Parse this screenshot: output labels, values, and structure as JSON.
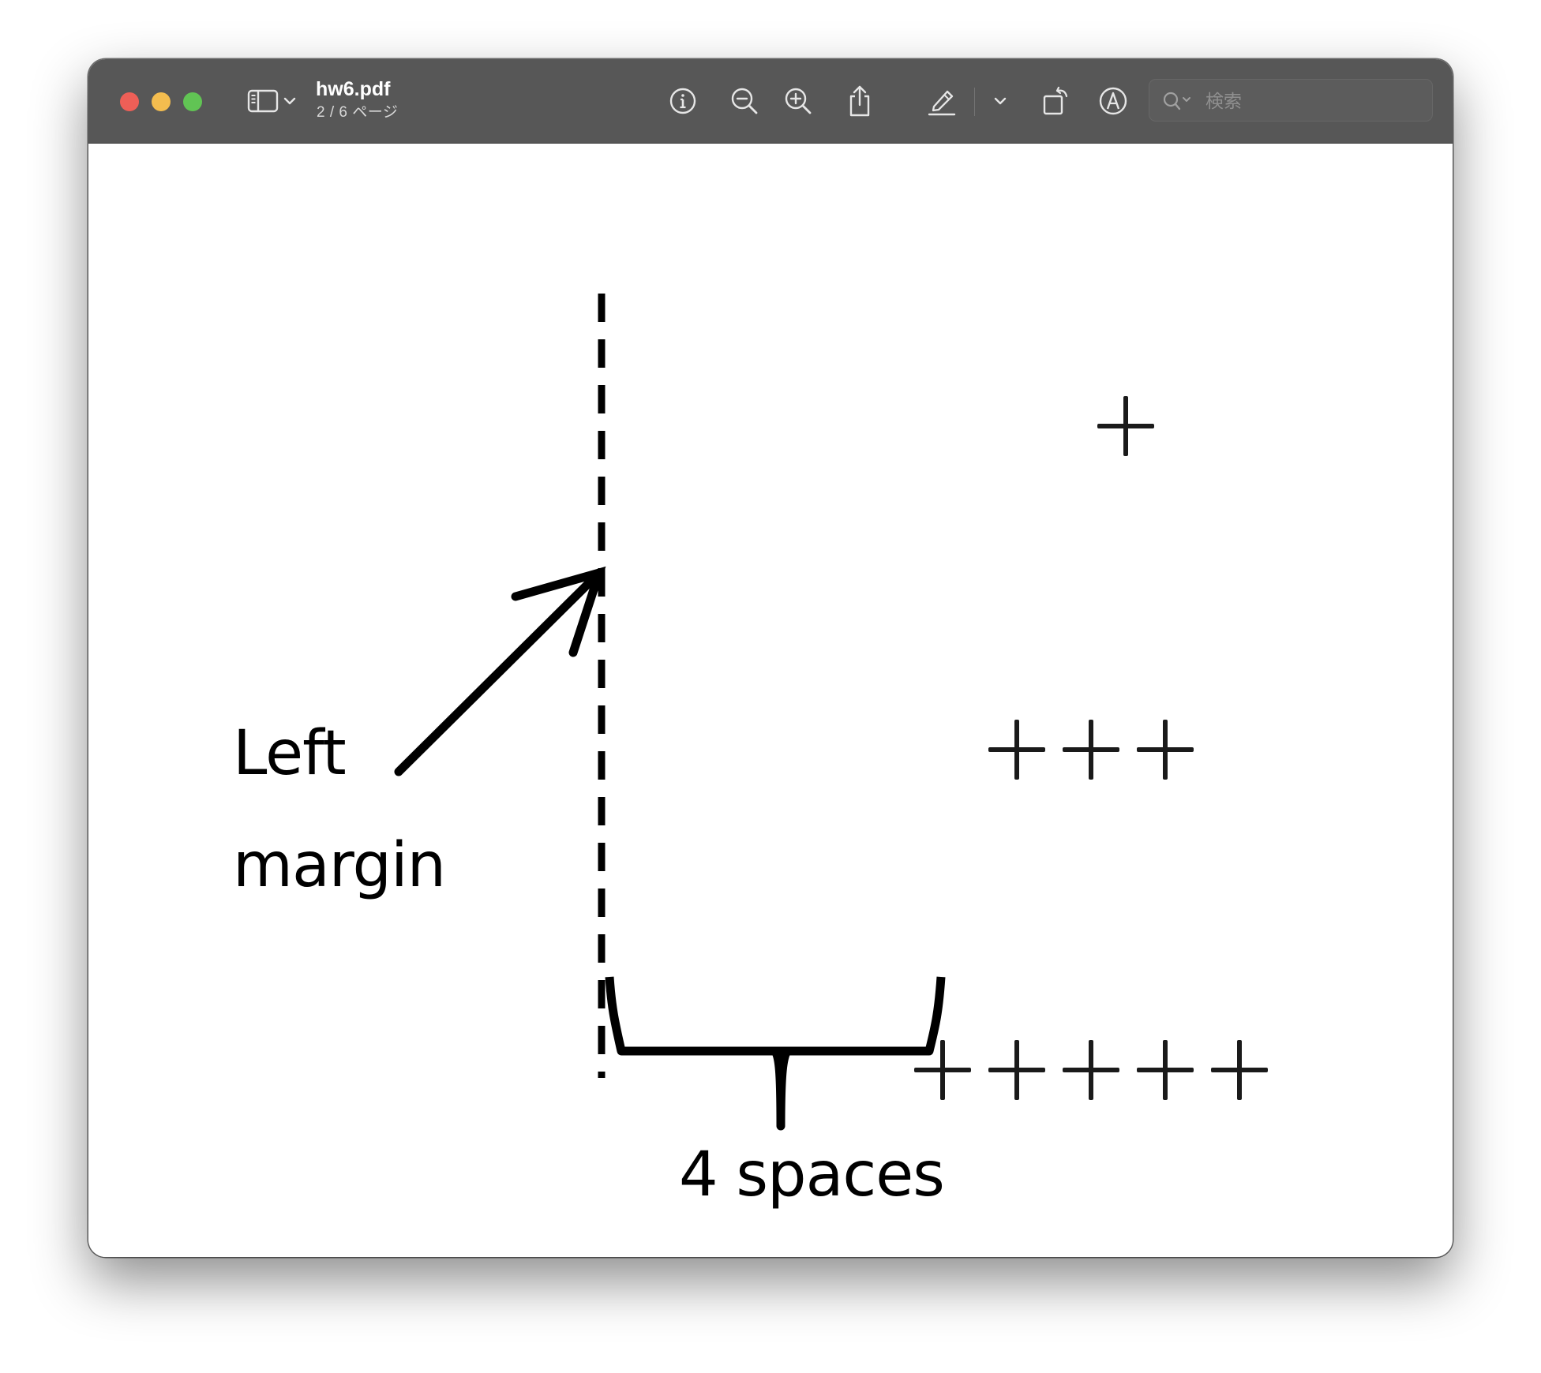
{
  "window": {
    "document_name": "hw6.pdf",
    "page_indicator": "2 / 6 ページ"
  },
  "toolbar": {
    "icons": [
      "sidebar-toggle-icon",
      "chevron-down-icon",
      "info-icon",
      "zoom-out-icon",
      "zoom-in-icon",
      "share-icon",
      "highlight-pen-icon",
      "chevron-down-icon",
      "rotate-icon",
      "markup-icon",
      "search-icon"
    ],
    "search_placeholder": "検索"
  },
  "colors": {
    "toolbar_bg": "#575757",
    "close": "#ee5f57",
    "minimize": "#f4bd4f",
    "zoom": "#61c454",
    "ink": "#000000"
  },
  "page_content": {
    "label_left_line1": "Left",
    "label_left_line2": "margin",
    "label_bracket": "4 spaces",
    "rows": [
      {
        "plus_count": 1
      },
      {
        "plus_count": 3
      },
      {
        "plus_count": 5
      }
    ]
  }
}
